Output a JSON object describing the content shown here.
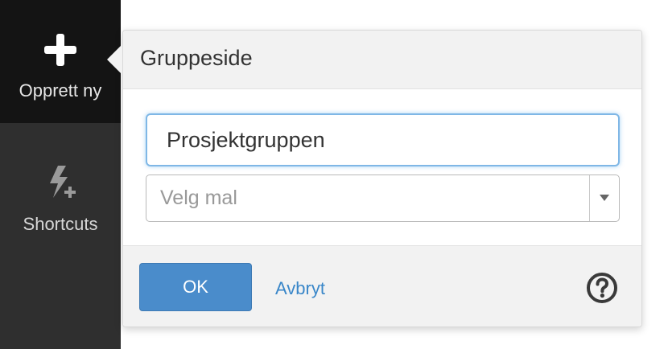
{
  "sidebar": {
    "create": {
      "label": "Opprett ny",
      "icon": "plus-icon"
    },
    "shortcuts": {
      "label": "Shortcuts",
      "icon": "bolt-plus-icon"
    }
  },
  "dialog": {
    "title": "Gruppeside",
    "name_input": {
      "value": "Prosjektgruppen"
    },
    "template_select": {
      "placeholder": "Velg mal"
    },
    "ok_label": "OK",
    "cancel_label": "Avbryt",
    "help_icon": "question-circle-icon"
  },
  "colors": {
    "sidebar_bg": "#2f2f2f",
    "sidebar_active_bg": "#141414",
    "primary_button": "#4a8ccb",
    "link": "#3a87c9",
    "focus_border": "#7fb7e6"
  }
}
